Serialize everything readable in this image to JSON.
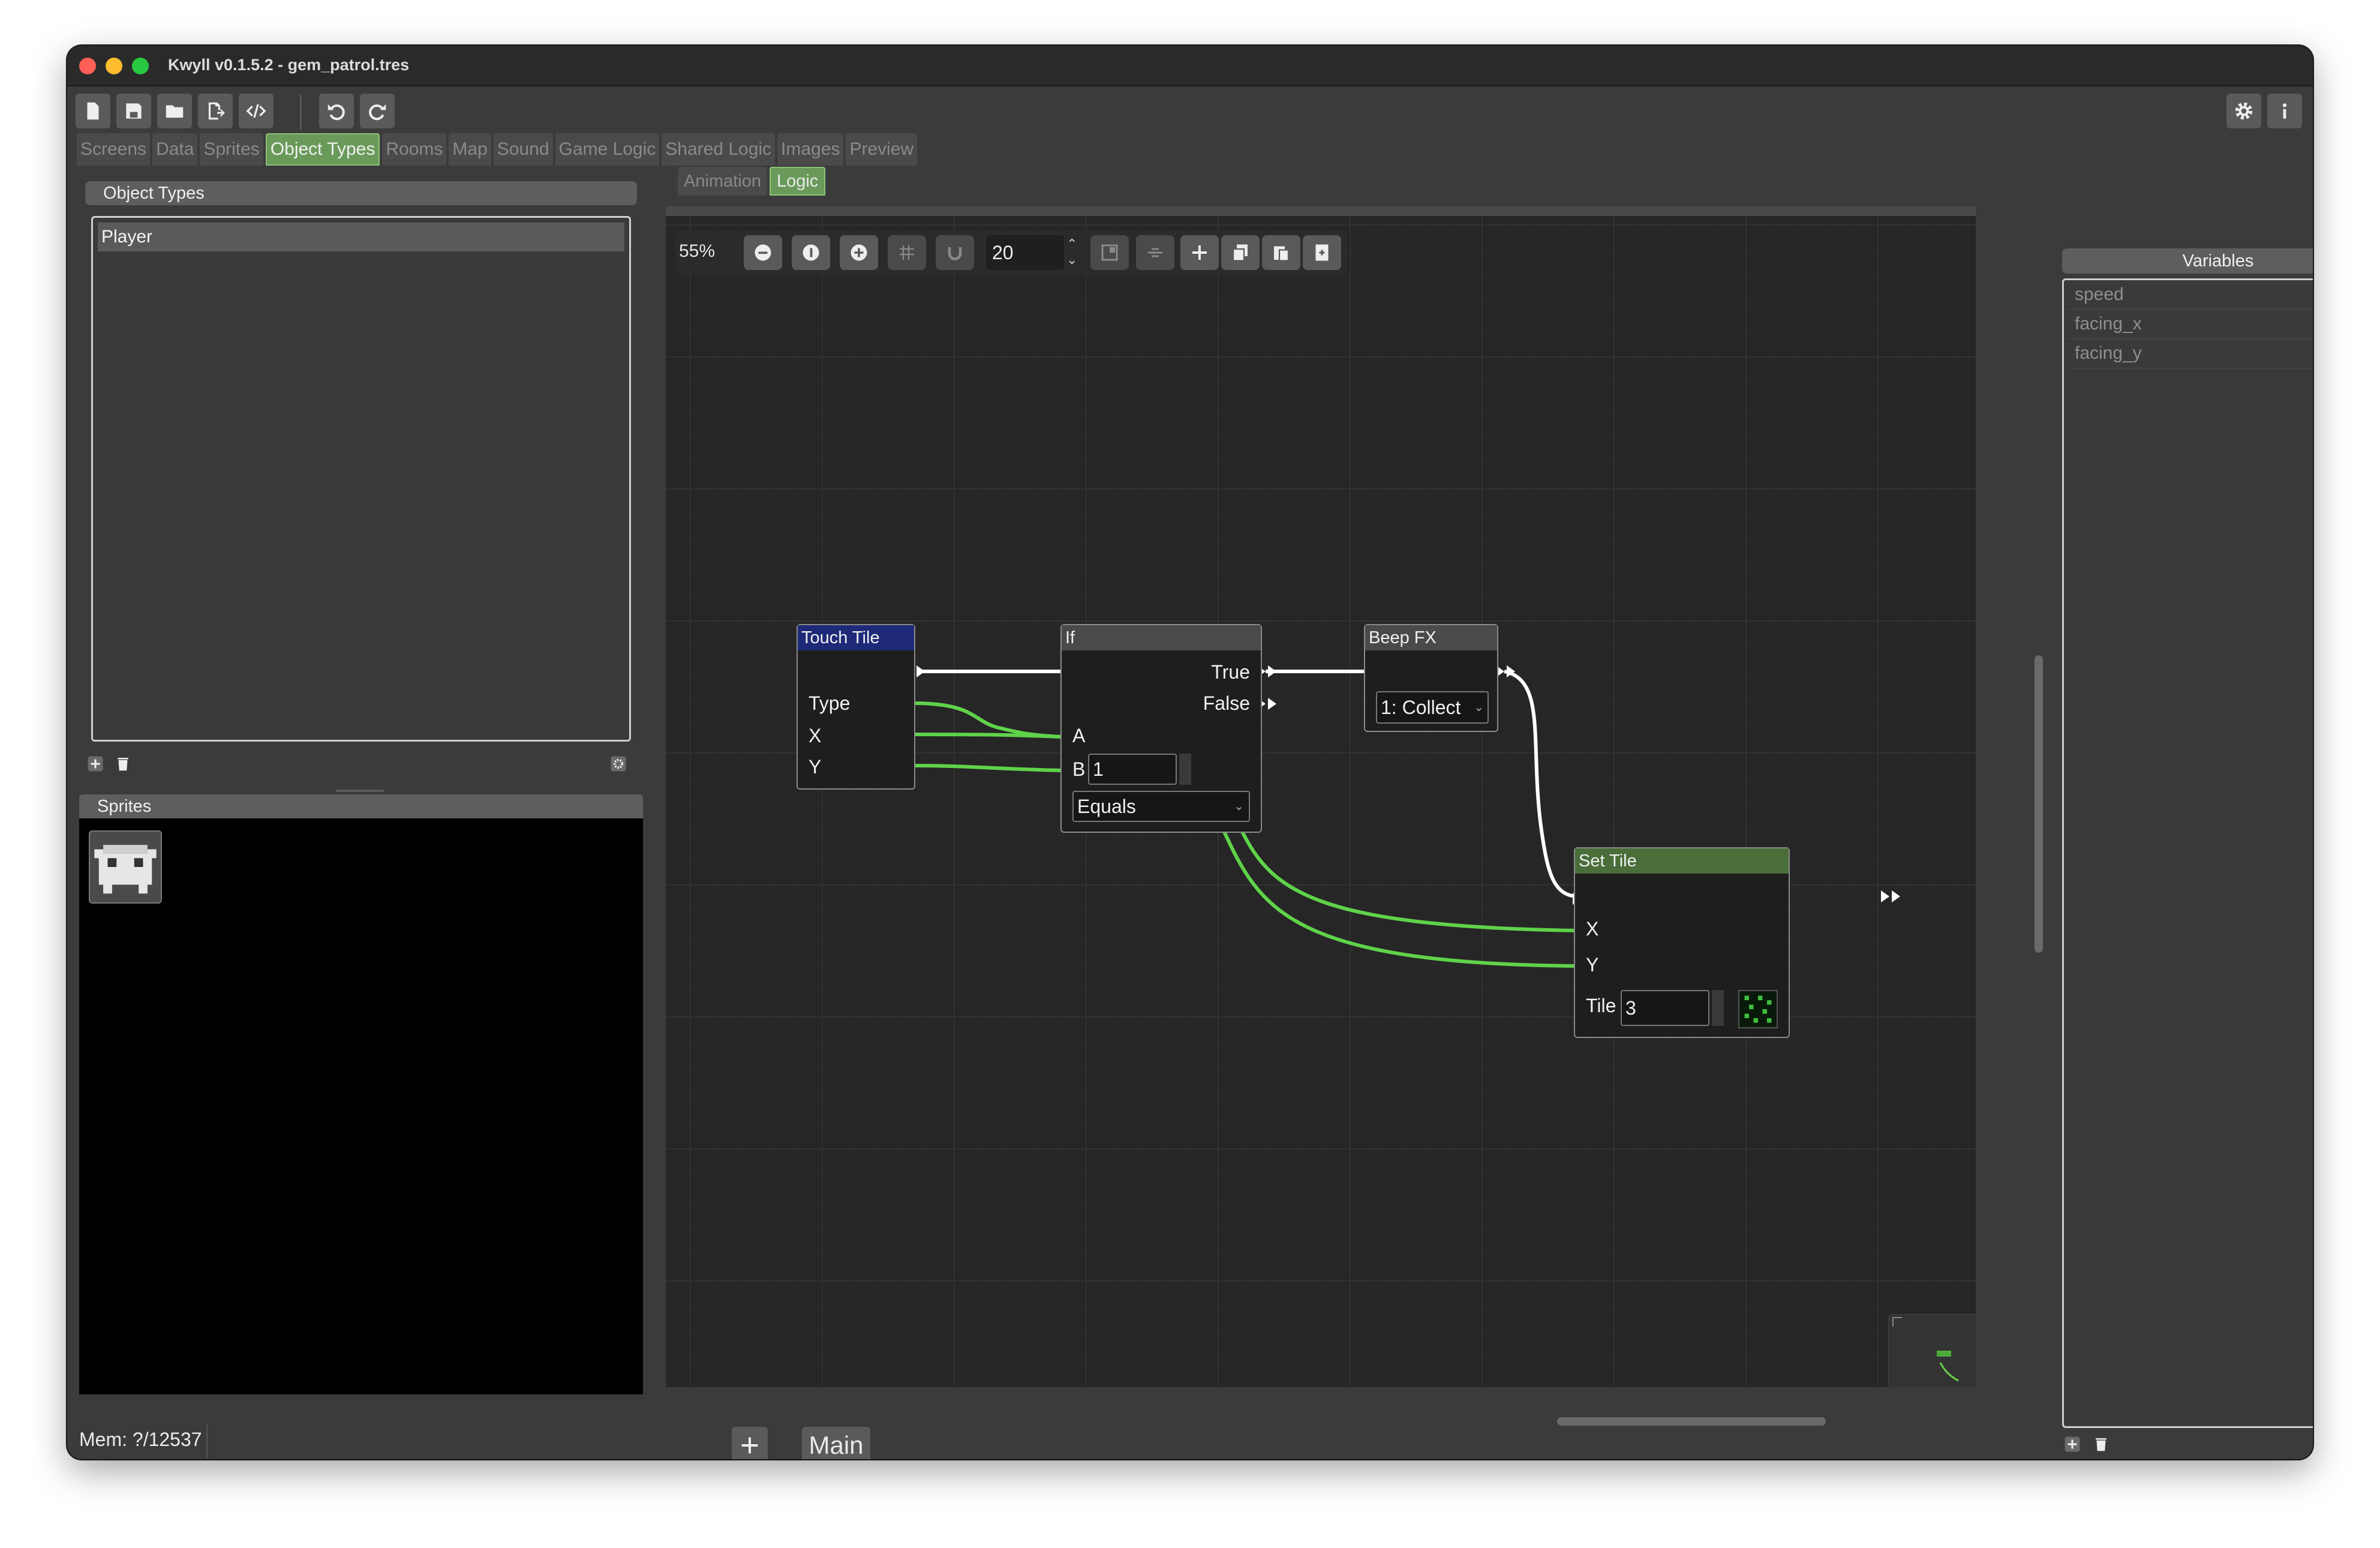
{
  "window": {
    "title": "Kwyll v0.1.5.2 - gem_patrol.tres"
  },
  "main_tabs": [
    "Screens",
    "Data",
    "Sprites",
    "Object Types",
    "Rooms",
    "Map",
    "Sound",
    "Game Logic",
    "Shared Logic",
    "Images",
    "Preview"
  ],
  "sub_tabs": [
    "Animation",
    "Logic"
  ],
  "object_types": {
    "header": "Object Types",
    "items": [
      "Player"
    ]
  },
  "sprites": {
    "header": "Sprites"
  },
  "graph_toolbar": {
    "zoom": "55%",
    "snap": "20"
  },
  "nodes": {
    "touch_tile": {
      "title": "Touch Tile",
      "ports": [
        "Type",
        "X",
        "Y"
      ]
    },
    "if": {
      "title": "If",
      "true_label": "True",
      "false_label": "False",
      "a_label": "A",
      "b_label": "B",
      "b_value": "1",
      "operator": "Equals"
    },
    "beep_fx": {
      "title": "Beep FX",
      "sound": "1: Collect"
    },
    "set_tile": {
      "title": "Set Tile",
      "x_label": "X",
      "y_label": "Y",
      "tile_label": "Tile",
      "tile_value": "3"
    }
  },
  "logic_tabs": {
    "main": "Main"
  },
  "variables": {
    "header": "Variables",
    "items": [
      "speed",
      "facing_x",
      "facing_y"
    ]
  },
  "status": {
    "mem": "Mem: ?/12537"
  },
  "colors": {
    "accent_tab": "#6a9a5a",
    "wire_data": "#5fd34a",
    "wire_exec": "#ffffff",
    "touch_tile_header": "#1e2a78",
    "set_tile_header": "#4a6e3a"
  }
}
